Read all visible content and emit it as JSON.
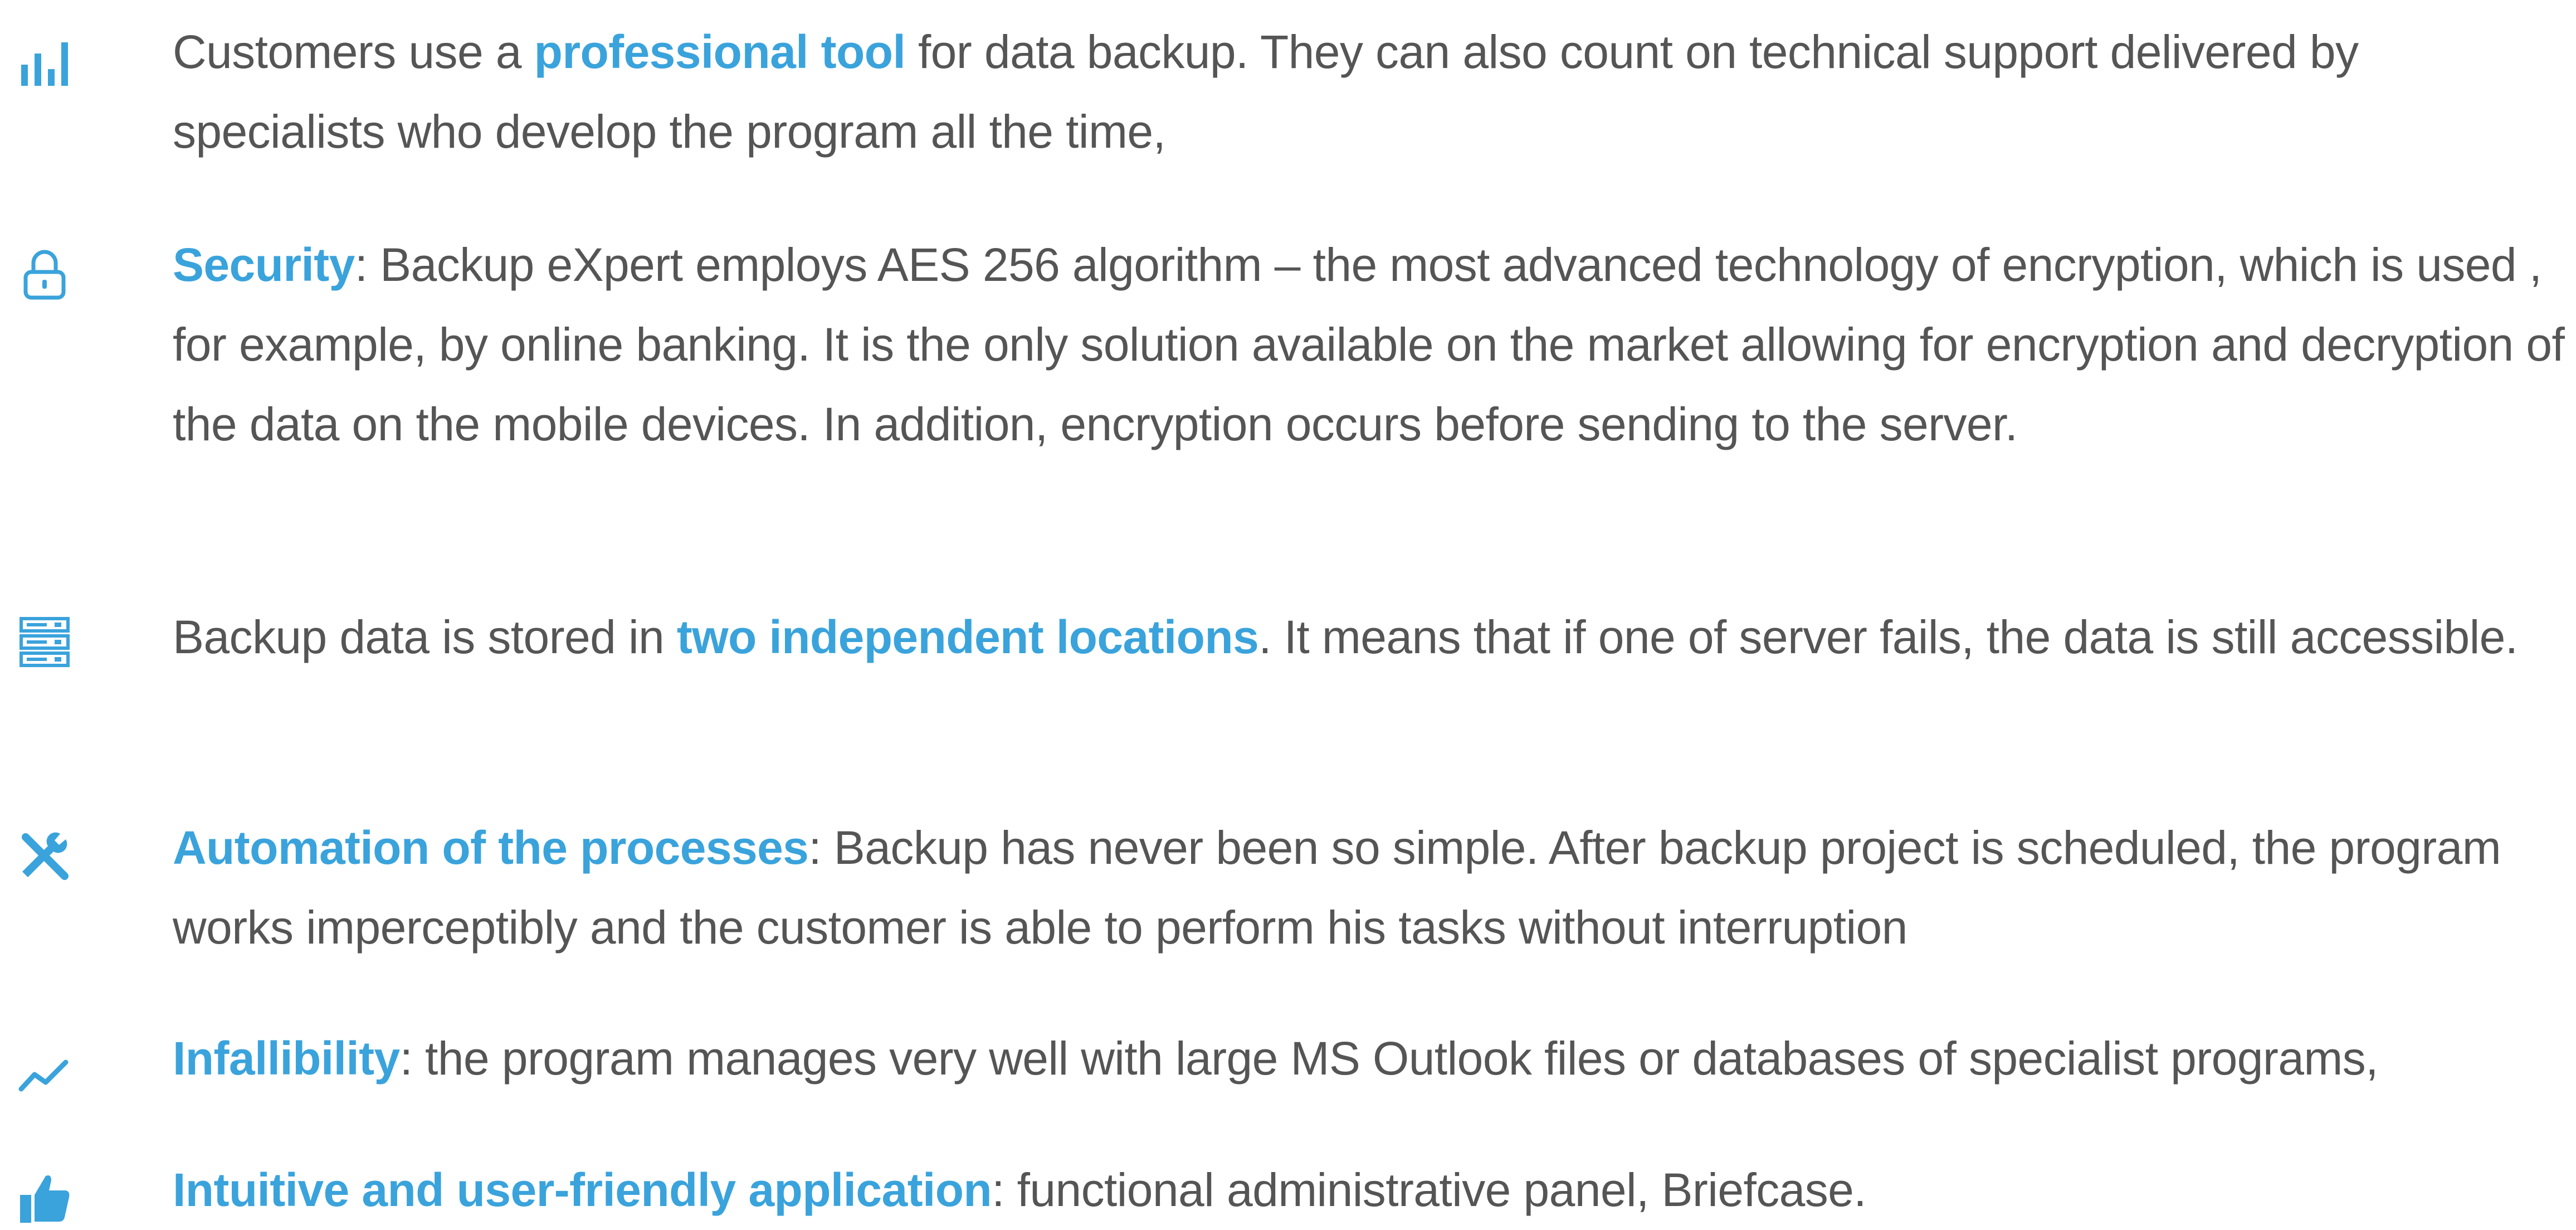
{
  "colors": {
    "accent": "#3aa3dc",
    "text": "#555555",
    "background": "#ffffff"
  },
  "features": [
    {
      "icon": "bar-chart-icon",
      "pre": "Customers use a ",
      "highlight": "professional tool",
      "post": " for data backup. They can also count on technical support delivered by specialists who develop the program all the time,"
    },
    {
      "icon": "lock-icon",
      "pre": "",
      "highlight": "Security",
      "post": ": Backup eXpert employs AES 256 algorithm – the most advanced technology of encryption, which is used , for example, by online banking. It is the only solution available on the market allowing for encryption and decryption of the data on the mobile devices. In addition, encryption occurs before sending to the server."
    },
    {
      "icon": "server-icon",
      "pre": "Backup data is stored in ",
      "highlight": "two independent locations",
      "post": ". It means that if one of server fails, the data is still accessible."
    },
    {
      "icon": "tools-icon",
      "pre": "",
      "highlight": "Automation of the processes",
      "post": ": Backup has never been so simple. After backup project is scheduled, the program works imperceptibly and the customer is able to perform his tasks without interruption"
    },
    {
      "icon": "line-chart-icon",
      "pre": "",
      "highlight": "Infallibility",
      "post": ": the program manages very well with large MS Outlook files or databases of specialist programs,"
    },
    {
      "icon": "thumbs-up-icon",
      "pre": "",
      "highlight": "Intuitive and user-friendly application",
      "post": ": functional administrative panel, Briefcase."
    }
  ]
}
